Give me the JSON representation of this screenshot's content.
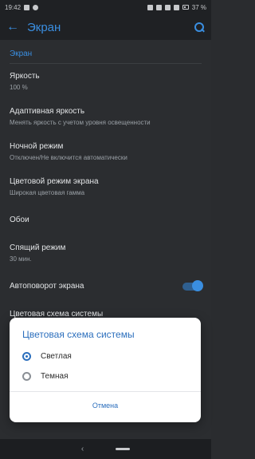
{
  "status_bar": {
    "time": "19:42",
    "battery": "37 %"
  },
  "app_bar": {
    "title": "Экран"
  },
  "settings": {
    "section_header": "Экран",
    "items": [
      {
        "title": "Яркость",
        "subtitle": "100 %"
      },
      {
        "title": "Адаптивная яркость",
        "subtitle": "Менять яркость с учетом уровня освещенности"
      },
      {
        "title": "Ночной режим",
        "subtitle": "Отключен/Не включится автоматически"
      },
      {
        "title": "Цветовой режим экрана",
        "subtitle": "Широкая цветовая гамма"
      },
      {
        "title": "Обои",
        "subtitle": ""
      },
      {
        "title": "Спящий режим",
        "subtitle": "30 мин."
      },
      {
        "title": "Автоповорот экрана",
        "subtitle": "",
        "toggle_on": true
      },
      {
        "title": "Цветовая схема системы",
        "subtitle": ""
      }
    ]
  },
  "dialog": {
    "title": "Цветовая схема системы",
    "options": [
      {
        "label": "Светлая",
        "selected": true
      },
      {
        "label": "Темная",
        "selected": false
      }
    ],
    "cancel_label": "Отмена"
  },
  "colors": {
    "accent": "#3a8ee0",
    "dialog_accent": "#2c6fbd"
  }
}
